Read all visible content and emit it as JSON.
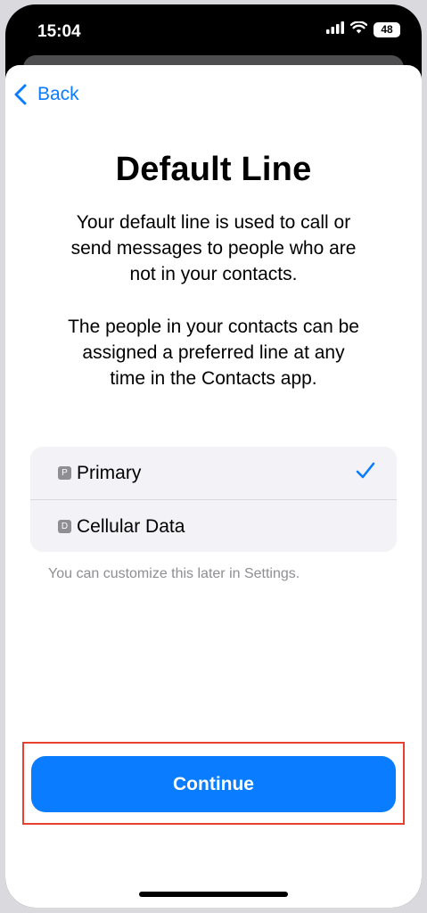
{
  "status_bar": {
    "time": "15:04",
    "battery": "48",
    "icons": [
      "cellular-signal-icon",
      "wifi-icon",
      "battery-icon"
    ]
  },
  "nav": {
    "back_label": "Back",
    "back_icon": "chevron-left-icon"
  },
  "content": {
    "title": "Default Line",
    "paragraph1": "Your default line is used to call or send messages to people who are not in your contacts.",
    "paragraph2": "The people in your contacts can be assigned a preferred line at any time in the Contacts app."
  },
  "lines": [
    {
      "badge": "P",
      "label": "Primary",
      "selected": true
    },
    {
      "badge": "D",
      "label": "Cellular Data",
      "selected": false
    }
  ],
  "footnote": "You can customize this later in Settings.",
  "continue_label": "Continue",
  "colors": {
    "accent": "#0a7cff",
    "highlight": "#e8412f",
    "list_bg": "#f2f2f7",
    "secondary_text": "#8e8e93"
  }
}
